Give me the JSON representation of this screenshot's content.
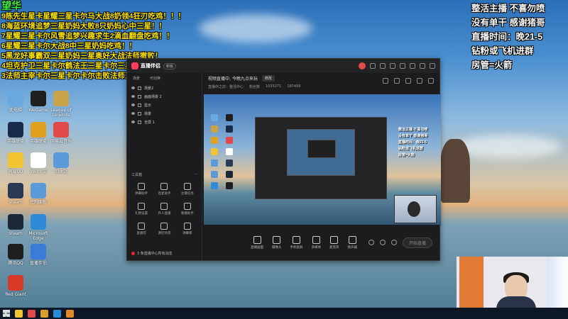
{
  "overlay_left": {
    "title": "望华",
    "lines": [
      "9陈先生星卡星耀三星卡尔马大战8奶领4狂刃吃鸡！！！",
      "8海蓝环境追梦三星奶妈大败8只奶妈心中三星！！",
      "7星耀三星卡尔风雪追梦兴趣求生2滴血翻盘吃鸡！！",
      "6星耀三星卡尔大战8中三星奶妈吃鸡！！",
      "5黑龙好事霸双三星奶妈三星奥好大战法师撤败！",
      "4坦克护卫三星卡尔鹤法王三星卡尔三星吃鸡！",
      "3法师主宰卡尔三星卡尔卡尔击败法师三星奥好降吃鸡！"
    ]
  },
  "overlay_right": {
    "lines": [
      "整活主播 不喜勿喷",
      "没有单干 感谢猪哥",
      "直播时间：晚21-5",
      "钻粉或飞机进群",
      "房管=火箭"
    ]
  },
  "desktop_icons": [
    {
      "label": "此电脑",
      "color": "#6aa8e0"
    },
    {
      "label": "WeGame",
      "color": "#1f1f1f"
    },
    {
      "label": "League of Legends",
      "color": "#c9a24a"
    },
    {
      "label": "英雄联盟",
      "color": "#1a2a4a"
    },
    {
      "label": "英雄联盟",
      "color": "#e0a020"
    },
    {
      "label": "网易云音乐",
      "color": "#e24a4a"
    },
    {
      "label": "网易UU",
      "color": "#f3c431"
    },
    {
      "label": "Word 文",
      "color": "#ffffff"
    },
    {
      "label": "回收站",
      "color": "#5a9ad8"
    },
    {
      "label": "Steam",
      "color": "#2a3a55"
    },
    {
      "label": "控制面板",
      "color": "#5a9ad8"
    },
    {
      "label": "Steam",
      "color": "#1b2838"
    },
    {
      "label": "Microsoft Edge",
      "color": "#2f8ad8"
    },
    {
      "label": "腾讯QQ",
      "color": "#1f1f1f"
    },
    {
      "label": "直播伴侣",
      "color": "#3a7ad8"
    },
    {
      "label": "Red Giant",
      "color": "#d83a2a"
    }
  ],
  "app": {
    "name": "直播伴侣",
    "badge": "新版",
    "tabs": [
      "场景",
      "可切换"
    ],
    "scenes": [
      "场景2",
      "画面场景 2",
      "显示",
      "场景",
      "全屏 1"
    ],
    "tools_title": "工具箱",
    "tools": [
      "弹幕助手",
      "连麦助手",
      "主播任务",
      "礼物设置",
      "开人直播",
      "看播助手",
      "直播音",
      "源控场景",
      "弹幕库"
    ],
    "bottom_tip": "3 条直播中心所有消息",
    "stream_title": "视频直播中, 今晚九点来玩",
    "edit_label": "修改",
    "meta": [
      "直播中之前：整活中心",
      "粉丝数",
      "1035271",
      "187499"
    ],
    "preview_text": [
      "整活主播 不喜勿喷",
      "没有单干 感谢猪哥",
      "直播时间：晚21-5",
      "钻粉或飞机进群",
      "房管=火箭"
    ],
    "controls": [
      "直播画面",
      "摄像头",
      "手机投屏",
      "多媒体",
      "麦克风",
      "扬声器"
    ],
    "go_live": "开始直播"
  },
  "taskbar_apps": [
    {
      "name": "file-explorer-icon",
      "color": "#f3c431"
    },
    {
      "name": "app-icon",
      "color": "#e24a4a"
    },
    {
      "name": "wegame-icon",
      "color": "#d8a02a"
    },
    {
      "name": "app-icon",
      "color": "#2a8ad8"
    },
    {
      "name": "app-icon",
      "color": "#e28a2a"
    }
  ]
}
